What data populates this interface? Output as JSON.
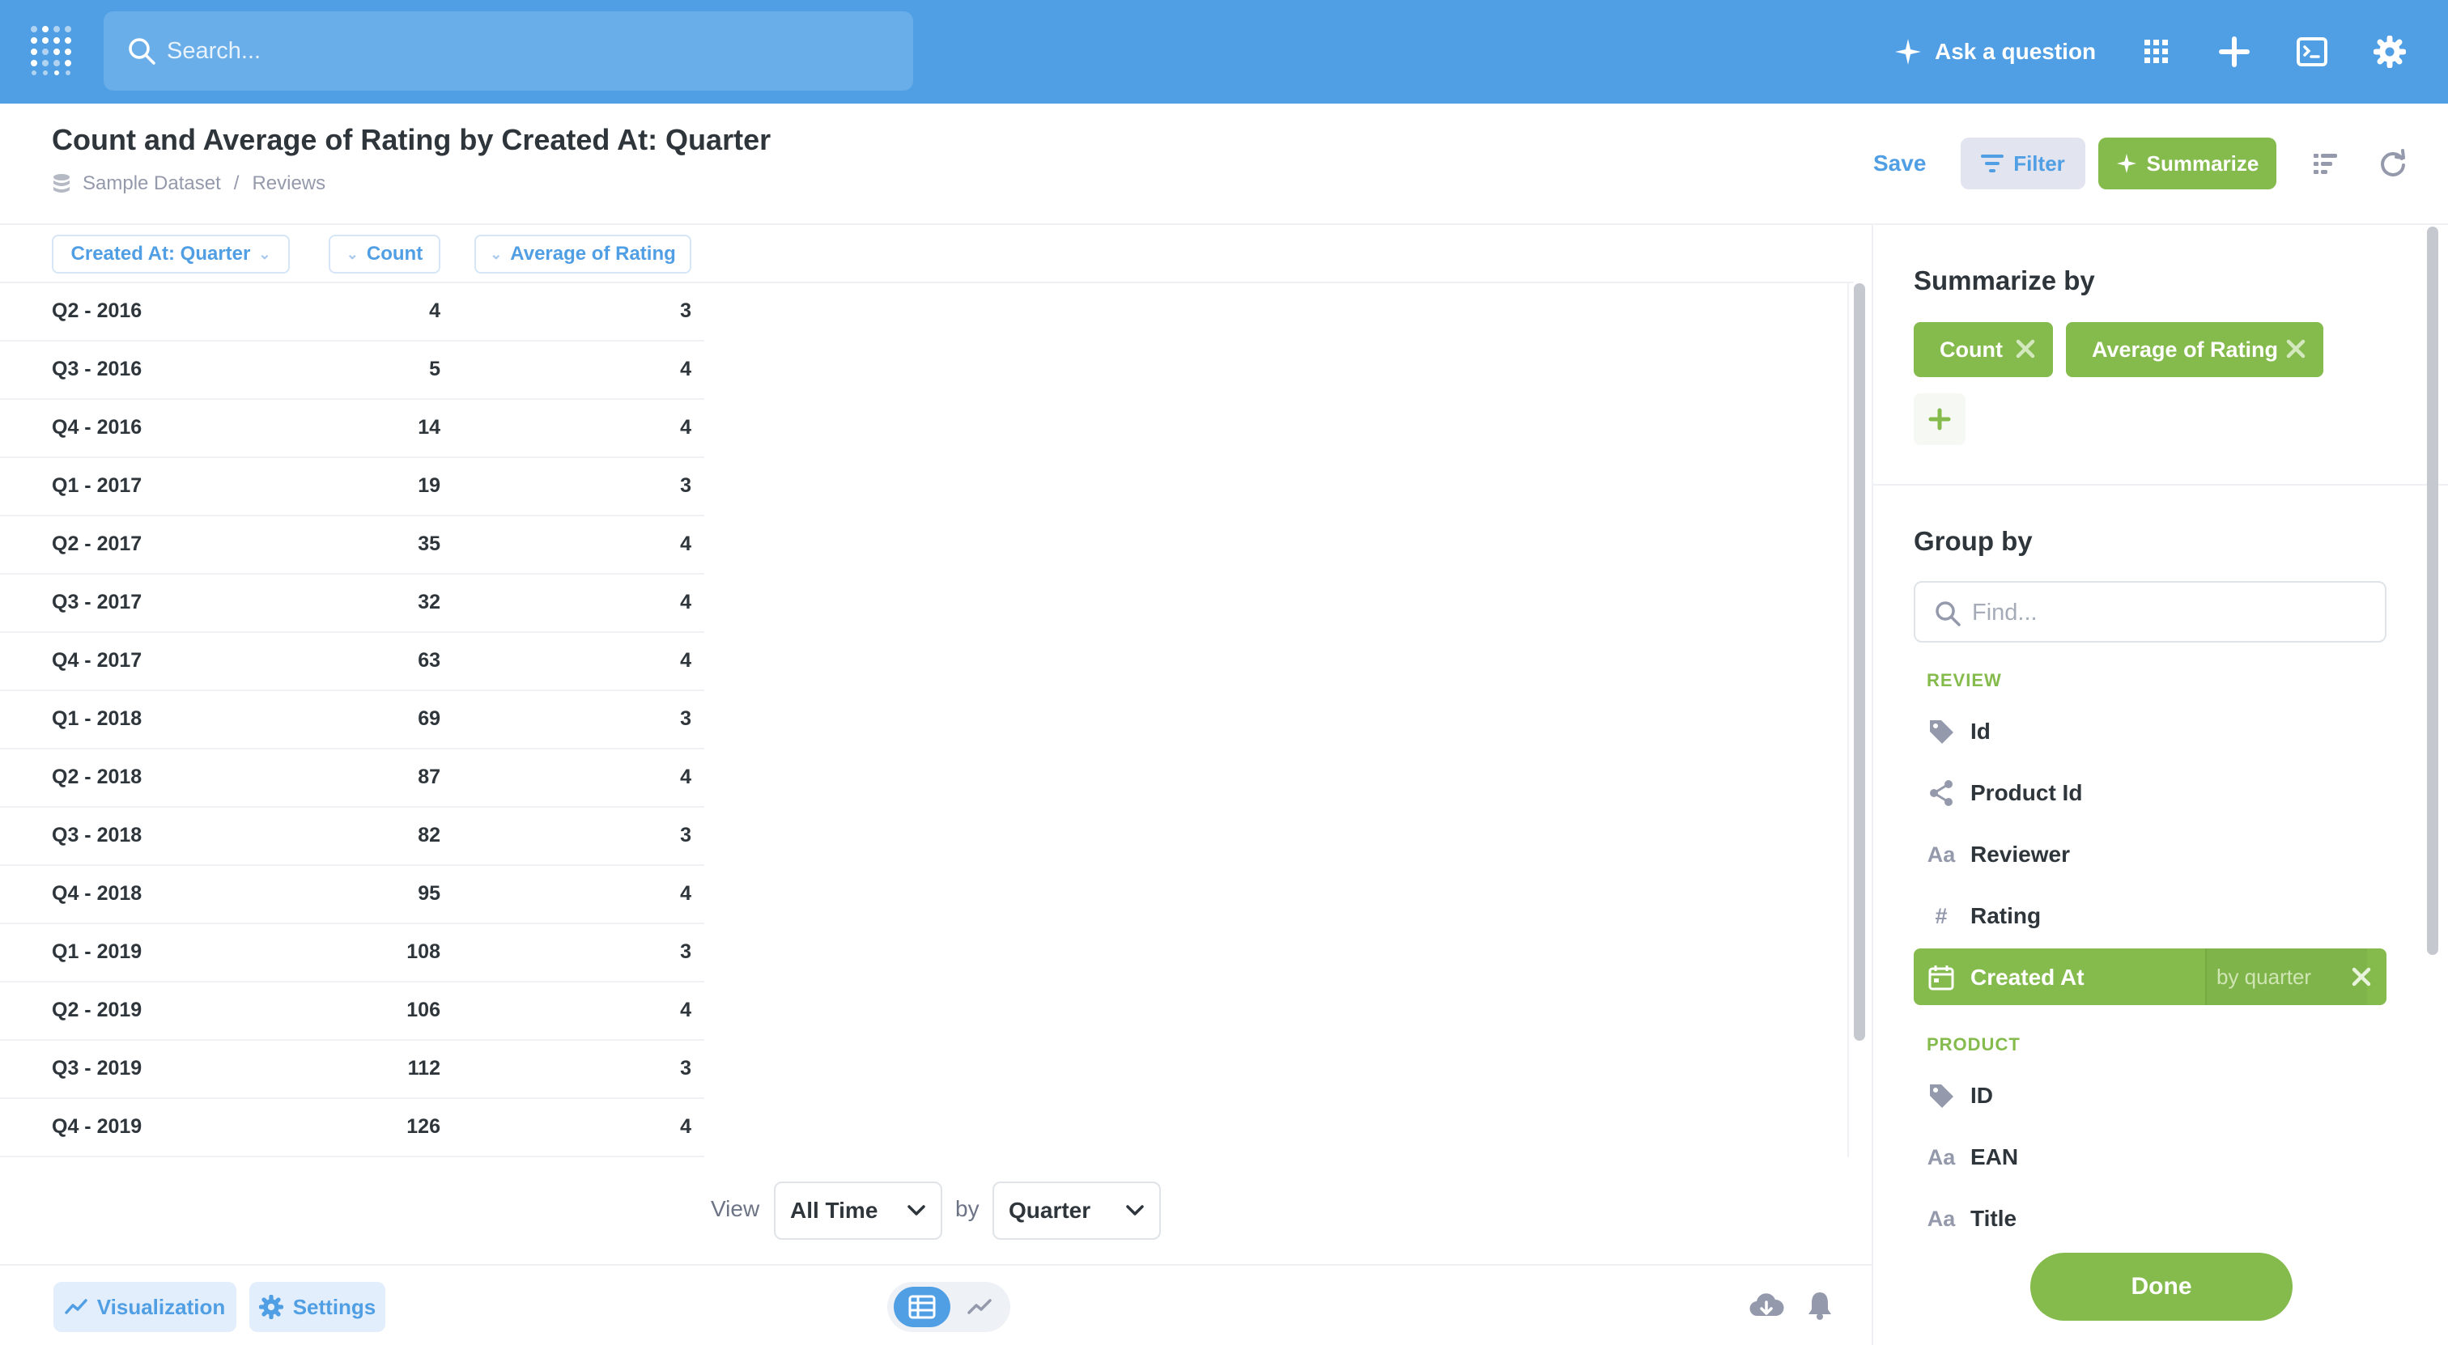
{
  "topbar": {
    "search_placeholder": "Search...",
    "ask_label": "Ask a question",
    "icons": [
      "logo-icon",
      "search-icon",
      "sparkle-icon",
      "grid-icon",
      "plus-icon",
      "notebook-icon",
      "gear-icon"
    ]
  },
  "header": {
    "title": "Count and Average of Rating by Created At: Quarter",
    "breadcrumb": [
      "Sample Dataset",
      "Reviews"
    ],
    "save_label": "Save",
    "filter_label": "Filter",
    "summarize_label": "Summarize"
  },
  "table": {
    "columns": [
      "Created At: Quarter",
      "Count",
      "Average of Rating"
    ],
    "rows": [
      [
        "Q2 - 2016",
        "4",
        "3"
      ],
      [
        "Q3 - 2016",
        "5",
        "4"
      ],
      [
        "Q4 - 2016",
        "14",
        "4"
      ],
      [
        "Q1 - 2017",
        "19",
        "3"
      ],
      [
        "Q2 - 2017",
        "35",
        "4"
      ],
      [
        "Q3 - 2017",
        "32",
        "4"
      ],
      [
        "Q4 - 2017",
        "63",
        "4"
      ],
      [
        "Q1 - 2018",
        "69",
        "3"
      ],
      [
        "Q2 - 2018",
        "87",
        "4"
      ],
      [
        "Q3 - 2018",
        "82",
        "3"
      ],
      [
        "Q4 - 2018",
        "95",
        "4"
      ],
      [
        "Q1 - 2019",
        "108",
        "3"
      ],
      [
        "Q2 - 2019",
        "106",
        "4"
      ],
      [
        "Q3 - 2019",
        "112",
        "3"
      ],
      [
        "Q4 - 2019",
        "126",
        "4"
      ]
    ]
  },
  "time_controls": {
    "view_label": "View",
    "view_value": "All Time",
    "by_label": "by",
    "by_value": "Quarter"
  },
  "footer": {
    "visualization_label": "Visualization",
    "settings_label": "Settings",
    "view_mode": "table"
  },
  "sidebar": {
    "summarize_heading": "Summarize by",
    "metrics": [
      "Count",
      "Average of Rating"
    ],
    "group_heading": "Group by",
    "find_placeholder": "Find...",
    "sections": [
      {
        "name": "REVIEW",
        "fields": [
          {
            "label": "Id",
            "icon": "tag-icon"
          },
          {
            "label": "Product Id",
            "icon": "connections-icon"
          },
          {
            "label": "Reviewer",
            "icon": "Aa"
          },
          {
            "label": "Rating",
            "icon": "#"
          },
          {
            "label": "Created At",
            "icon": "calendar-icon",
            "active": true,
            "bucket": "by quarter"
          }
        ]
      },
      {
        "name": "PRODUCT",
        "fields": [
          {
            "label": "ID",
            "icon": "tag-icon"
          },
          {
            "label": "EAN",
            "icon": "Aa"
          },
          {
            "label": "Title",
            "icon": "Aa"
          }
        ]
      }
    ],
    "done_label": "Done"
  },
  "colors": {
    "brand_blue": "#509ee3",
    "summarize_green": "#84bb4c",
    "text_dark": "#2e353b",
    "text_muted": "#949aab"
  }
}
